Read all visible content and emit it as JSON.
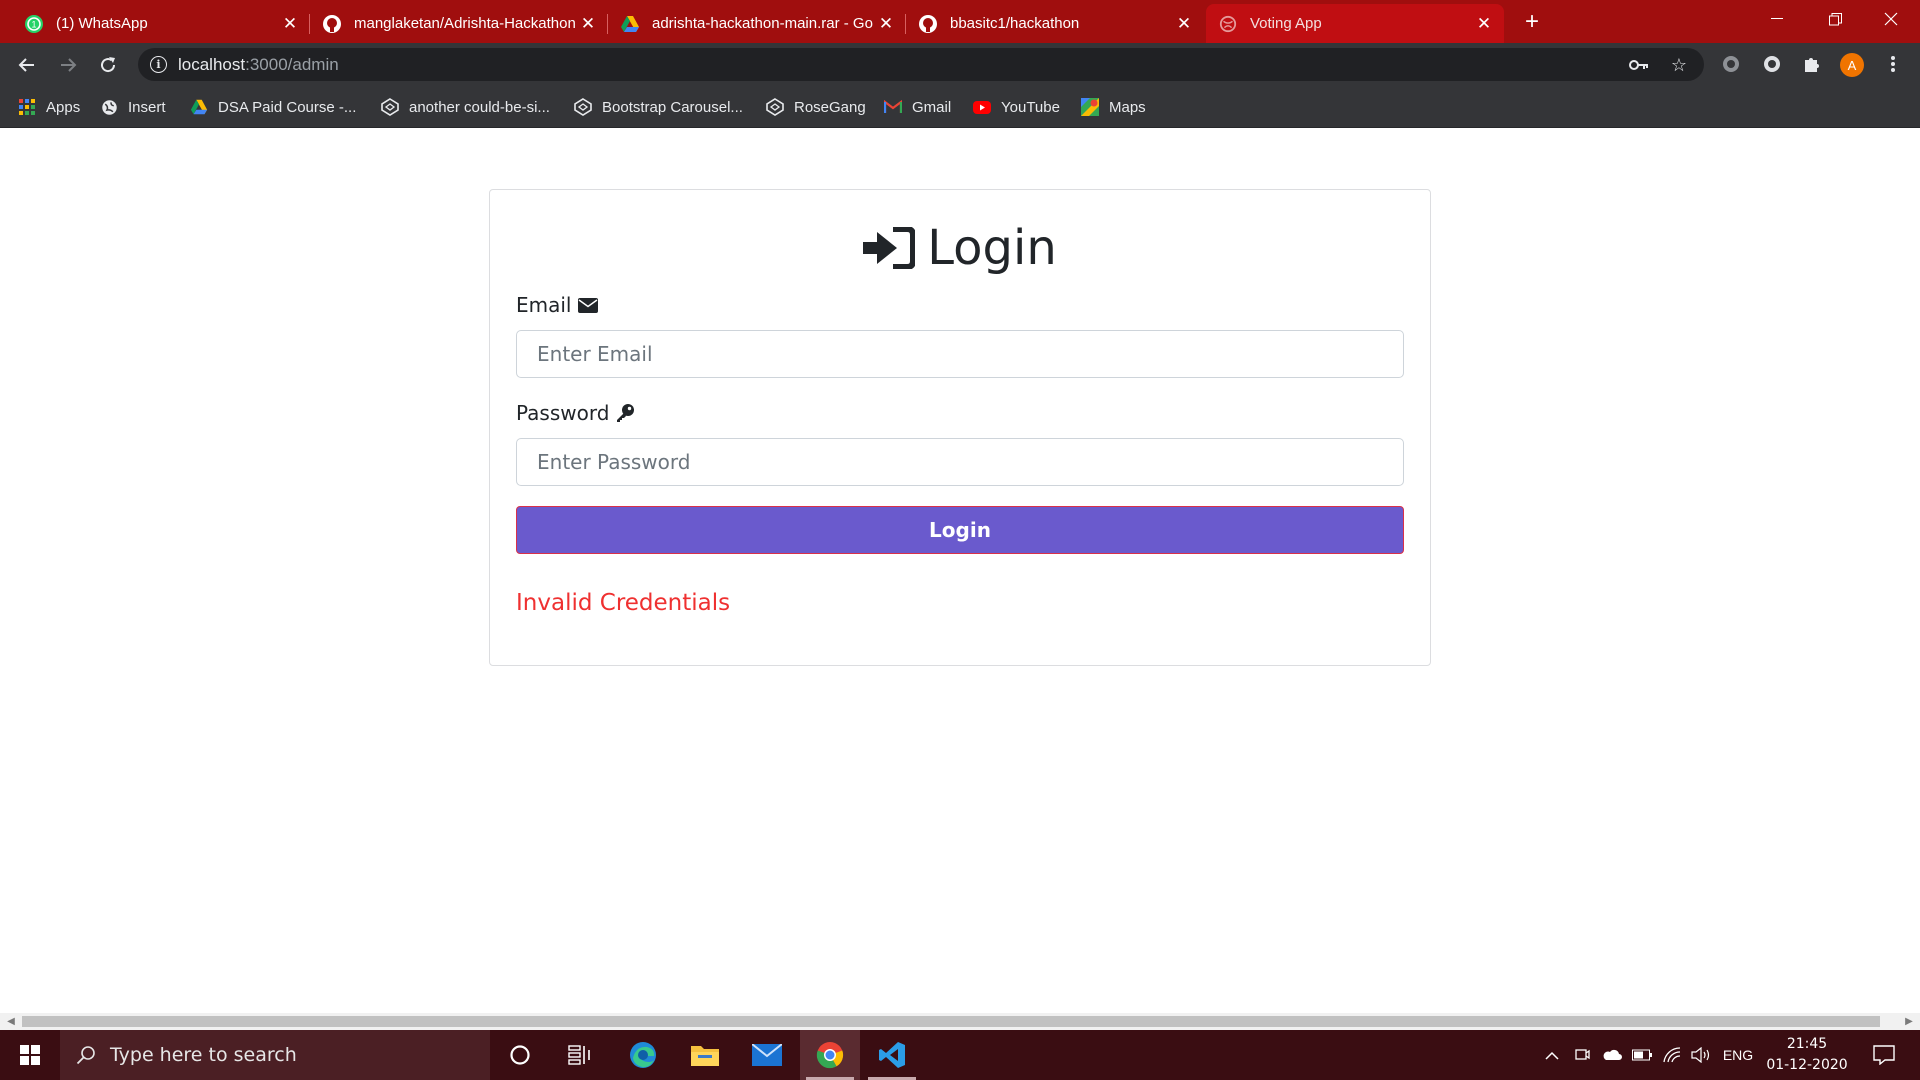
{
  "browser": {
    "tabs": [
      {
        "title": "(1) WhatsApp",
        "icon": "whatsapp-icon"
      },
      {
        "title": "manglaketan/Adrishta-Hackathon",
        "icon": "github-icon"
      },
      {
        "title": "adrishta-hackathon-main.rar - Go",
        "icon": "google-drive-icon"
      },
      {
        "title": "bbasitc1/hackathon",
        "icon": "github-icon"
      },
      {
        "title": "Voting App",
        "icon": "globe-icon"
      }
    ],
    "address": {
      "host": "localhost",
      "path": ":3000/admin"
    },
    "bookmarks": [
      {
        "label": "Apps",
        "icon": "apps-grid-icon"
      },
      {
        "label": "Insert",
        "icon": "globe-icon"
      },
      {
        "label": "DSA Paid Course -...",
        "icon": "google-drive-icon"
      },
      {
        "label": "another could-be-si...",
        "icon": "codepen-icon"
      },
      {
        "label": "Bootstrap Carousel...",
        "icon": "codepen-icon"
      },
      {
        "label": "RoseGang",
        "icon": "codepen-icon"
      },
      {
        "label": "Gmail",
        "icon": "gmail-icon"
      },
      {
        "label": "YouTube",
        "icon": "youtube-icon"
      },
      {
        "label": "Maps",
        "icon": "maps-icon"
      }
    ],
    "profile_initial": "A"
  },
  "login": {
    "heading": "Login",
    "email_label": "Email",
    "email_placeholder": "Enter Email",
    "password_label": "Password",
    "password_placeholder": "Enter Password",
    "button_label": "Login",
    "error_message": "Invalid Credentials"
  },
  "taskbar": {
    "search_placeholder": "Type here to search",
    "language": "ENG",
    "time": "21:45",
    "date": "01-12-2020"
  },
  "colors": {
    "tabbar": "#a00e0e",
    "button": "#6a5acd",
    "error": "#ef3030",
    "taskbar": "#3a0d12"
  }
}
